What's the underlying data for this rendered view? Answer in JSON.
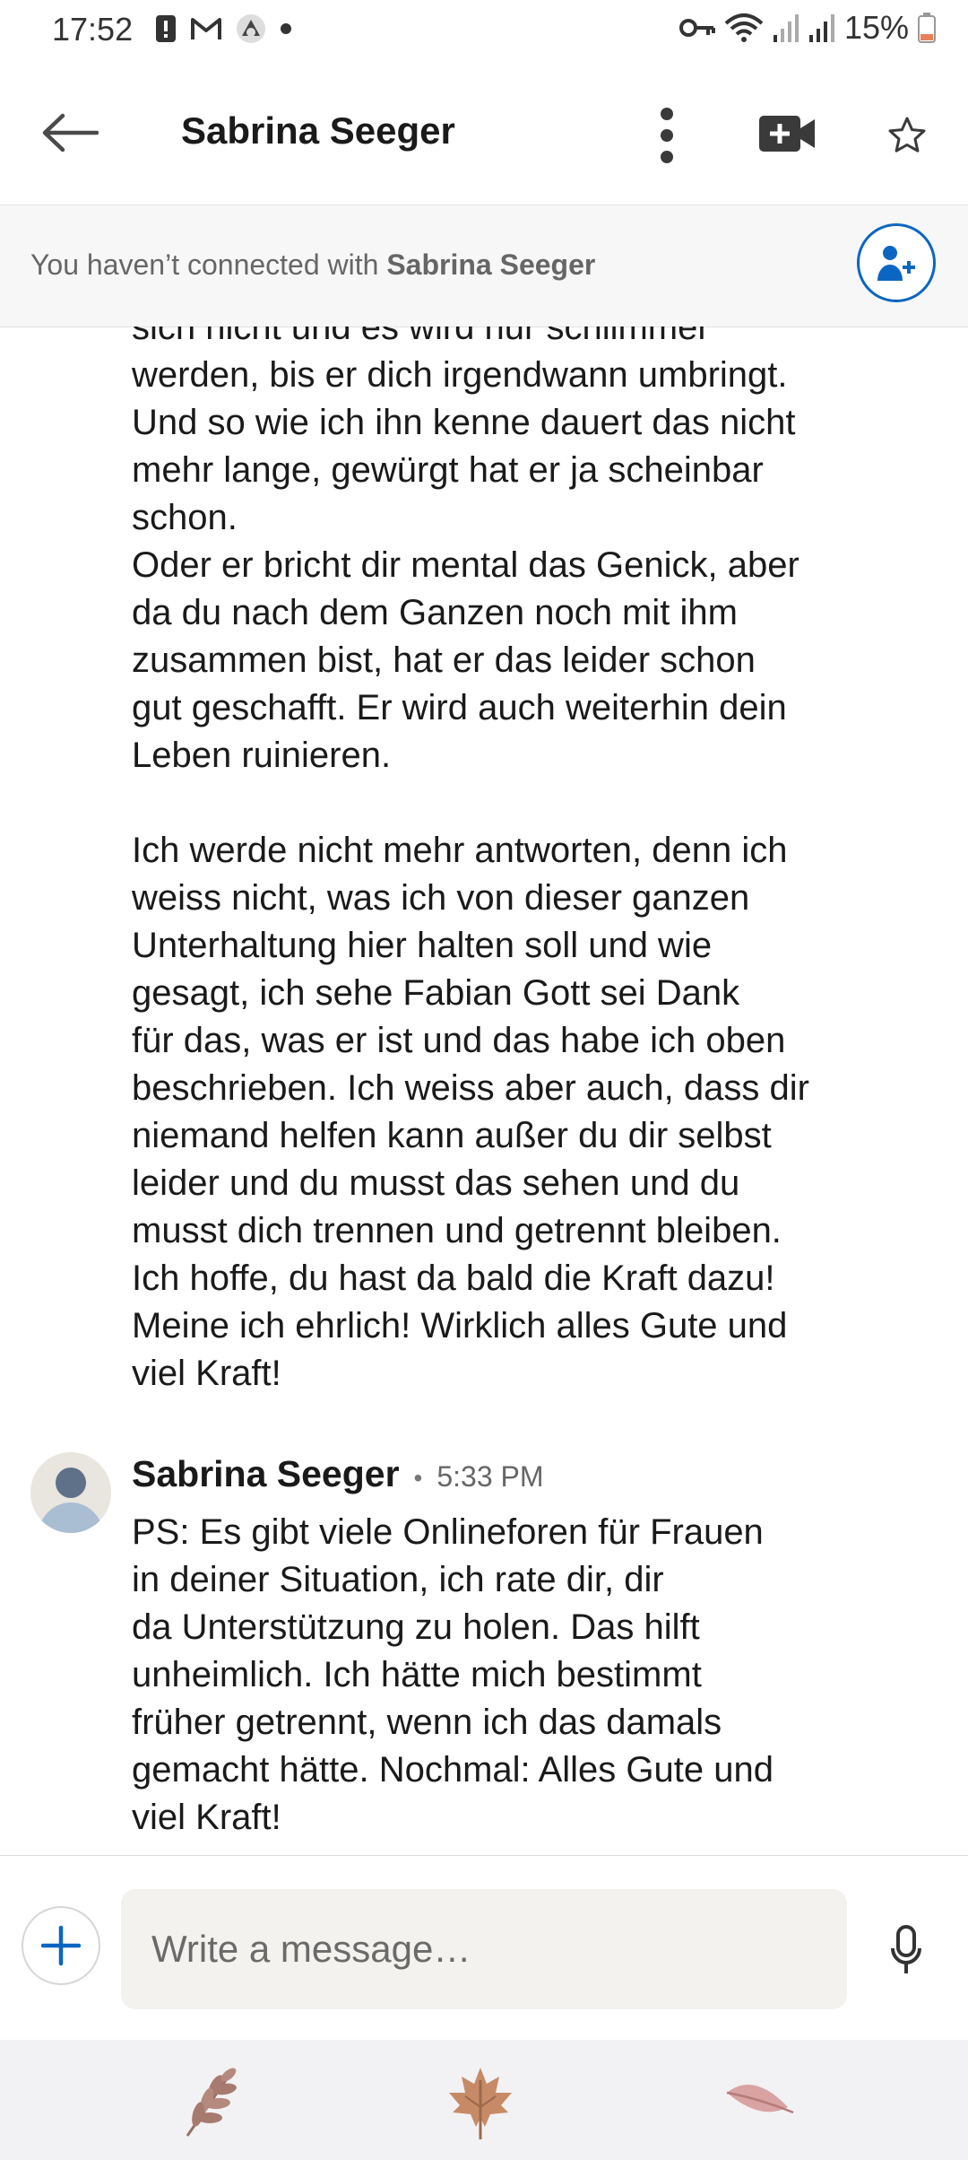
{
  "status_bar": {
    "time": "17:52",
    "battery": "15%",
    "left_icons": [
      "alert-icon",
      "gmail-icon",
      "app-icon",
      "dot-icon"
    ],
    "right_icons": [
      "vpn-key-icon",
      "wifi-icon",
      "signal-icon",
      "signal-icon",
      "battery-icon"
    ]
  },
  "header": {
    "title": "Sabrina Seeger",
    "icons": [
      "back-arrow-icon",
      "more-vertical-icon",
      "video-call-icon",
      "star-icon"
    ]
  },
  "connection_banner": {
    "prefix": "You haven’t connected with ",
    "name": "Sabrina Seeger",
    "button_icon": "add-person-icon"
  },
  "messages": [
    {
      "text": "sich nicht und es wird nur schlimmer\nwerden, bis er dich irgendwann umbringt.\nUnd so wie ich ihn kenne dauert das nicht\nmehr lange, gewürgt hat er ja scheinbar\nschon.\nOder er bricht dir mental das Genick, aber\nda du nach dem Ganzen noch mit ihm\nzusammen bist, hat er das leider schon\ngut geschafft. Er wird auch weiterhin dein\nLeben ruinieren.\n\nIch werde nicht mehr antworten, denn ich\nweiss nicht, was ich von dieser ganzen\nUnterhaltung hier halten soll und wie\ngesagt, ich sehe Fabian Gott sei Dank\nfür das, was er ist und das habe ich oben\nbeschrieben. Ich weiss aber auch, dass dir\nniemand helfen kann außer du dir selbst\nleider und du musst das sehen und du\nmusst dich trennen und getrennt bleiben.\nIch hoffe, du hast da bald die Kraft dazu!\nMeine ich ehrlich! Wirklich alles Gute und\nviel Kraft!"
    },
    {
      "sender": "Sabrina Seeger",
      "separator": "•",
      "time": "5:33 PM",
      "text": "PS: Es gibt viele Onlineforen für Frauen\nin deiner Situation, ich rate dir, dir\nda Unterstützung zu holen. Das hilft\nunheimlich. Ich hätte mich bestimmt\nfrüher getrennt, wenn ich das damals\ngemacht hätte. Nochmal: Alles Gute und\nviel Kraft!"
    }
  ],
  "composer": {
    "placeholder": "Write a message…",
    "icons": [
      "plus-icon",
      "microphone-icon"
    ]
  },
  "keyboard_strip": {
    "icons": [
      "fern-leaf-icon",
      "maple-leaf-icon",
      "pink-leaf-icon"
    ]
  },
  "colors": {
    "accent": "#0a66c2",
    "banner_bg": "#f7f7f7",
    "input_bg": "#f3f2ef"
  }
}
